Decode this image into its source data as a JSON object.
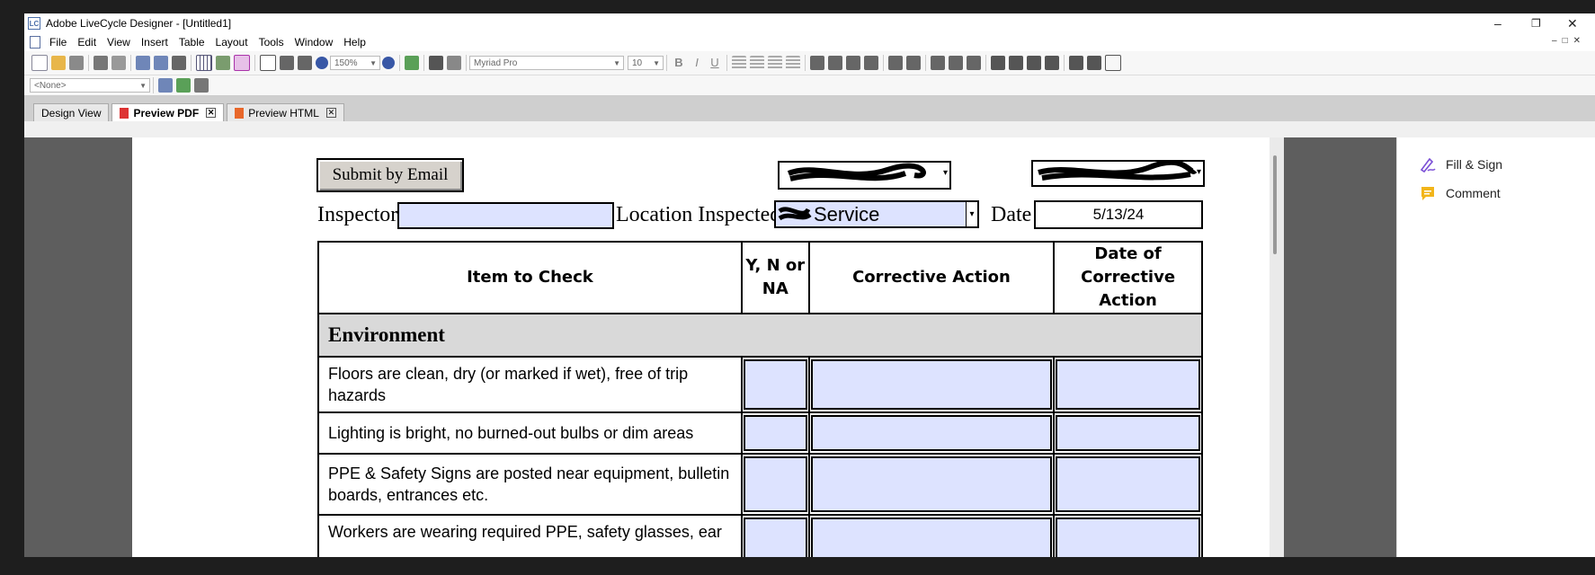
{
  "window": {
    "title": "Adobe LiveCycle Designer - [Untitled1]",
    "app_icon": "LC"
  },
  "menu": [
    "File",
    "Edit",
    "View",
    "Insert",
    "Table",
    "Layout",
    "Tools",
    "Window",
    "Help"
  ],
  "toolbar": {
    "zoom": "150%",
    "font": "Myriad Pro",
    "size": "10"
  },
  "toolbar2": {
    "style": "<None>"
  },
  "tabs": [
    {
      "label": "Design View"
    },
    {
      "label": "Preview PDF"
    },
    {
      "label": "Preview HTML"
    }
  ],
  "right_panel": {
    "fill_sign": "Fill & Sign",
    "comment": "Comment"
  },
  "form": {
    "submit_label": "Submit by Email",
    "inspector_label": "Inspector",
    "location_label": "Location Inspected",
    "location_value": "Service",
    "date_label": "Date",
    "date_value": "5/13/24",
    "headers": {
      "item": "Item to Check",
      "ynna": "Y, N or NA",
      "corrective": "Corrective Action",
      "date": "Date of Corrective Action"
    },
    "section": "Environment",
    "rows": [
      "Floors are clean, dry (or marked if wet), free of trip hazards",
      "Lighting is bright, no burned-out bulbs or dim areas",
      "PPE & Safety Signs are posted near equipment, bulletin boards, entrances etc.",
      "Workers are wearing required PPE, safety glasses, ear"
    ]
  },
  "colors": {
    "field_fill": "#dde3ff",
    "section_fill": "#d9d9d9",
    "workspace": "#5e5e5e"
  }
}
